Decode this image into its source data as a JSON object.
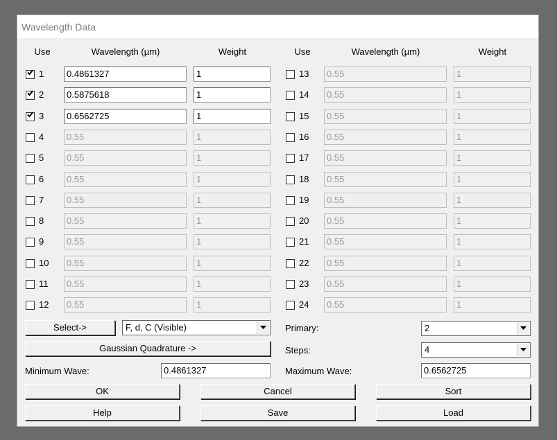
{
  "title": "Wavelength Data",
  "headers": {
    "use": "Use",
    "wavelength": "Wavelength (µm)",
    "weight": "Weight"
  },
  "rows": [
    {
      "num": "1",
      "checked": true,
      "wavelength": "0.4861327",
      "weight": "1"
    },
    {
      "num": "2",
      "checked": true,
      "wavelength": "0.5875618",
      "weight": "1"
    },
    {
      "num": "3",
      "checked": true,
      "wavelength": "0.6562725",
      "weight": "1"
    },
    {
      "num": "4",
      "checked": false,
      "wavelength": "0.55",
      "weight": "1"
    },
    {
      "num": "5",
      "checked": false,
      "wavelength": "0.55",
      "weight": "1"
    },
    {
      "num": "6",
      "checked": false,
      "wavelength": "0.55",
      "weight": "1"
    },
    {
      "num": "7",
      "checked": false,
      "wavelength": "0.55",
      "weight": "1"
    },
    {
      "num": "8",
      "checked": false,
      "wavelength": "0.55",
      "weight": "1"
    },
    {
      "num": "9",
      "checked": false,
      "wavelength": "0.55",
      "weight": "1"
    },
    {
      "num": "10",
      "checked": false,
      "wavelength": "0.55",
      "weight": "1"
    },
    {
      "num": "11",
      "checked": false,
      "wavelength": "0.55",
      "weight": "1"
    },
    {
      "num": "12",
      "checked": false,
      "wavelength": "0.55",
      "weight": "1"
    },
    {
      "num": "13",
      "checked": false,
      "wavelength": "0.55",
      "weight": "1"
    },
    {
      "num": "14",
      "checked": false,
      "wavelength": "0.55",
      "weight": "1"
    },
    {
      "num": "15",
      "checked": false,
      "wavelength": "0.55",
      "weight": "1"
    },
    {
      "num": "16",
      "checked": false,
      "wavelength": "0.55",
      "weight": "1"
    },
    {
      "num": "17",
      "checked": false,
      "wavelength": "0.55",
      "weight": "1"
    },
    {
      "num": "18",
      "checked": false,
      "wavelength": "0.55",
      "weight": "1"
    },
    {
      "num": "19",
      "checked": false,
      "wavelength": "0.55",
      "weight": "1"
    },
    {
      "num": "20",
      "checked": false,
      "wavelength": "0.55",
      "weight": "1"
    },
    {
      "num": "21",
      "checked": false,
      "wavelength": "0.55",
      "weight": "1"
    },
    {
      "num": "22",
      "checked": false,
      "wavelength": "0.55",
      "weight": "1"
    },
    {
      "num": "23",
      "checked": false,
      "wavelength": "0.55",
      "weight": "1"
    },
    {
      "num": "24",
      "checked": false,
      "wavelength": "0.55",
      "weight": "1"
    }
  ],
  "controls": {
    "select_button": "Select->",
    "select_preset": "F, d, C (Visible)",
    "gaussian_button": "Gaussian Quadrature ->",
    "primary_label": "Primary:",
    "primary_value": "2",
    "steps_label": "Steps:",
    "steps_value": "4",
    "min_wave_label": "Minimum Wave:",
    "min_wave_value": "0.4861327",
    "max_wave_label": "Maximum Wave:",
    "max_wave_value": "0.6562725"
  },
  "buttons": {
    "ok": "OK",
    "cancel": "Cancel",
    "sort": "Sort",
    "help": "Help",
    "save": "Save",
    "load": "Load"
  }
}
